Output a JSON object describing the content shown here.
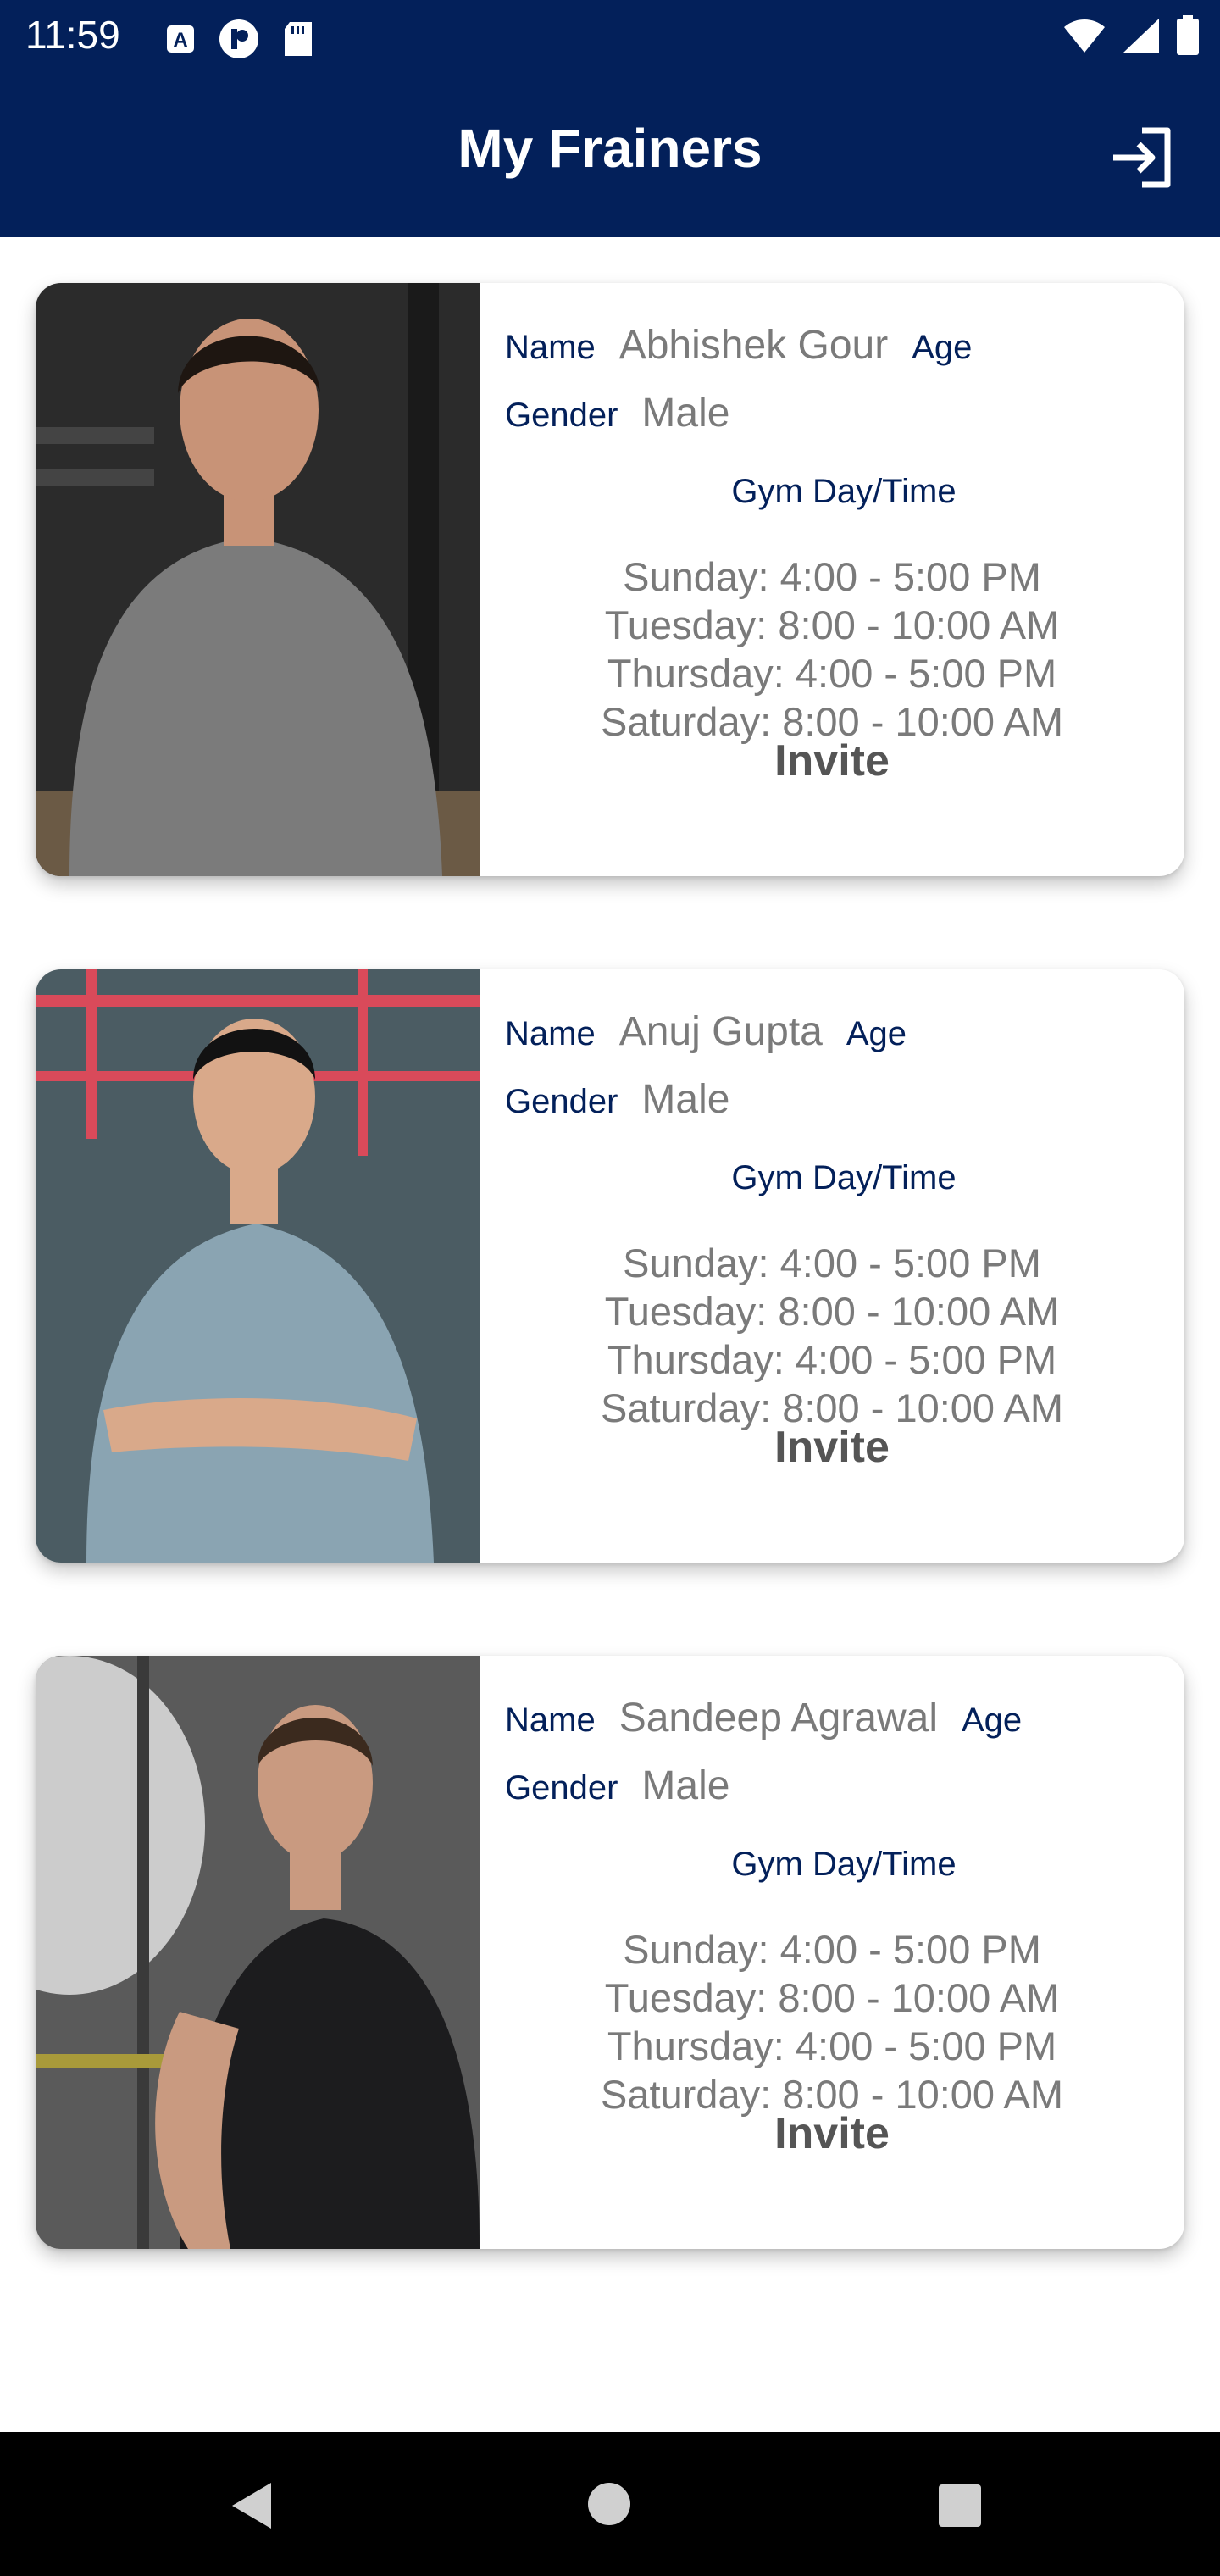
{
  "status_bar": {
    "time": "11:59",
    "left_icons": [
      "a-badge-icon",
      "p-badge-icon",
      "sd-card-icon"
    ],
    "right_icons": [
      "wifi-icon",
      "signal-icon",
      "battery-icon"
    ]
  },
  "app_bar": {
    "title": "My Frainers",
    "action_icon": "logout-icon"
  },
  "labels": {
    "name": "Name",
    "age": "Age",
    "gender": "Gender",
    "gym_day_time": "Gym Day/Time",
    "invite": "Invite"
  },
  "trainers": [
    {
      "name": "Abhishek Gour",
      "gender": "Male",
      "schedule": [
        "Sunday: 4:00 - 5:00 PM",
        "Tuesday: 8:00 - 10:00 AM",
        "Thursday: 4:00 - 5:00 PM",
        "Saturday: 8:00 - 10:00 AM"
      ],
      "photo": {
        "shirt_color": "#7b7b7b",
        "bg_color": "#2b2b2b",
        "hair_color": "#1e1611",
        "skin_color": "#c89377"
      }
    },
    {
      "name": "Anuj Gupta",
      "gender": "Male",
      "schedule": [
        "Sunday: 4:00 - 5:00 PM",
        "Tuesday: 8:00 - 10:00 AM",
        "Thursday: 4:00 - 5:00 PM",
        "Saturday: 8:00 - 10:00 AM"
      ],
      "photo": {
        "shirt_color": "#8aa4b2",
        "bg_color": "#4b5c63",
        "hair_color": "#121212",
        "skin_color": "#d9a98a"
      }
    },
    {
      "name": "Sandeep Agrawal",
      "gender": "Male",
      "schedule": [
        "Sunday: 4:00 - 5:00 PM",
        "Tuesday: 8:00 - 10:00 AM",
        "Thursday: 4:00 - 5:00 PM",
        "Saturday: 8:00 - 10:00 AM"
      ],
      "photo": {
        "shirt_color": "#1c1c1e",
        "bg_color": "#5a5a5a",
        "hair_color": "#3b2a1e",
        "skin_color": "#c99a80"
      }
    }
  ],
  "colors": {
    "primary": "#03205a",
    "label_text": "#03205a",
    "value_text": "#7a7a7a",
    "invite_text": "#555555",
    "nav_bar": "#000000"
  },
  "nav_bar": {
    "icons": [
      "back-icon",
      "home-icon",
      "recents-icon"
    ]
  }
}
